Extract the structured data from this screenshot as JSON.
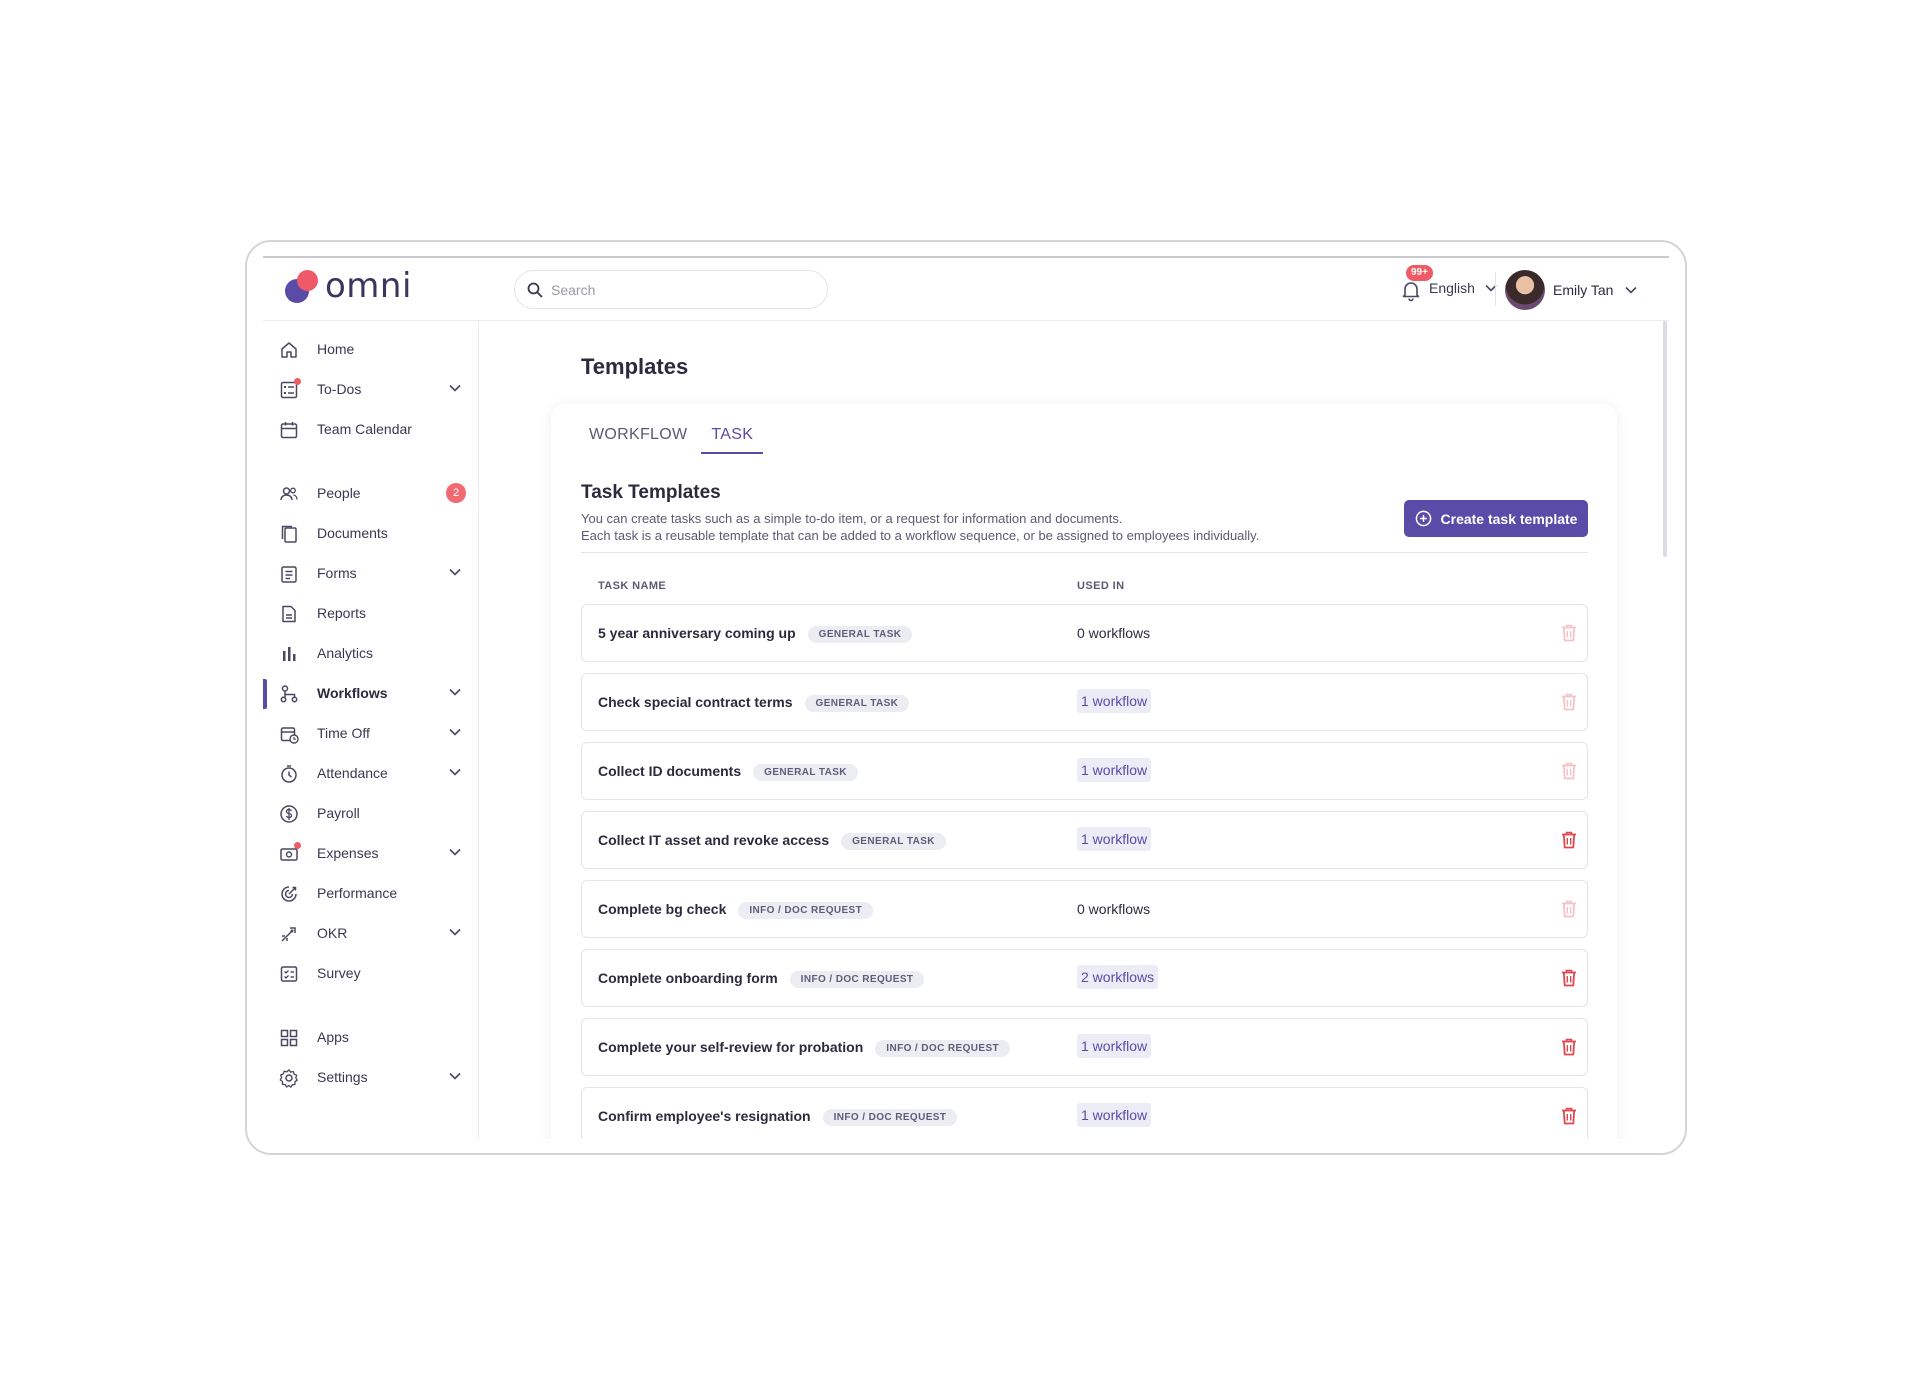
{
  "app": {
    "logo_text": "omni",
    "brand_purple": "#5b4ba8",
    "brand_red": "#ee5a67"
  },
  "header": {
    "search_placeholder": "Search",
    "notification_count": "99+",
    "language": "English",
    "user_name": "Emily Tan"
  },
  "sidebar": {
    "items": [
      {
        "label": "Home",
        "icon": "home-icon"
      },
      {
        "label": "To-Dos",
        "icon": "todo-icon",
        "expandable": true,
        "dot": true
      },
      {
        "label": "Team Calendar",
        "icon": "calendar-icon"
      },
      {
        "label": "People",
        "icon": "people-icon",
        "count": "2"
      },
      {
        "label": "Documents",
        "icon": "documents-icon"
      },
      {
        "label": "Forms",
        "icon": "forms-icon",
        "expandable": true
      },
      {
        "label": "Reports",
        "icon": "reports-icon"
      },
      {
        "label": "Analytics",
        "icon": "analytics-icon"
      },
      {
        "label": "Workflows",
        "icon": "workflows-icon",
        "expandable": true,
        "active": true
      },
      {
        "label": "Time Off",
        "icon": "time-off-icon",
        "expandable": true
      },
      {
        "label": "Attendance",
        "icon": "attendance-icon",
        "expandable": true
      },
      {
        "label": "Payroll",
        "icon": "payroll-icon"
      },
      {
        "label": "Expenses",
        "icon": "expenses-icon",
        "expandable": true,
        "dot": true
      },
      {
        "label": "Performance",
        "icon": "performance-icon"
      },
      {
        "label": "OKR",
        "icon": "okr-icon",
        "expandable": true
      },
      {
        "label": "Survey",
        "icon": "survey-icon"
      },
      {
        "label": "Apps",
        "icon": "apps-icon"
      },
      {
        "label": "Settings",
        "icon": "settings-icon",
        "expandable": true
      }
    ]
  },
  "main": {
    "page_title": "Templates",
    "tabs": [
      {
        "label": "WORKFLOW"
      },
      {
        "label": "TASK",
        "active": true
      }
    ],
    "section_title": "Task Templates",
    "description_line1": "You can create tasks such as a simple to-do item, or a request for information and documents.",
    "description_line2": "Each task is a reusable template that can be added to a workflow sequence, or be assigned to employees individually.",
    "create_button": "Create task template",
    "columns": {
      "name": "TASK NAME",
      "used_in": "USED IN"
    },
    "rows": [
      {
        "name": "5 year anniversary coming up",
        "tag": "GENERAL TASK",
        "used_in": "0 workflows",
        "linked": false,
        "deletable": false
      },
      {
        "name": "Check special contract terms",
        "tag": "GENERAL TASK",
        "used_in": "1 workflow",
        "linked": true,
        "deletable": false
      },
      {
        "name": "Collect ID documents",
        "tag": "GENERAL TASK",
        "used_in": "1 workflow",
        "linked": true,
        "deletable": false
      },
      {
        "name": "Collect IT asset and revoke access",
        "tag": "GENERAL TASK",
        "used_in": "1 workflow",
        "linked": true,
        "deletable": true
      },
      {
        "name": "Complete bg check",
        "tag": "INFO / DOC REQUEST",
        "used_in": "0 workflows",
        "linked": false,
        "deletable": false
      },
      {
        "name": "Complete onboarding form",
        "tag": "INFO / DOC REQUEST",
        "used_in": "2 workflows",
        "linked": true,
        "deletable": true
      },
      {
        "name": "Complete your self-review for probation",
        "tag": "INFO / DOC REQUEST",
        "used_in": "1 workflow",
        "linked": true,
        "deletable": true
      },
      {
        "name": "Confirm employee's resignation",
        "tag": "INFO / DOC REQUEST",
        "used_in": "1 workflow",
        "linked": true,
        "deletable": true
      }
    ]
  },
  "colors": {
    "delete_active": "#e0474f",
    "delete_disabled": "#f5c3c6"
  }
}
